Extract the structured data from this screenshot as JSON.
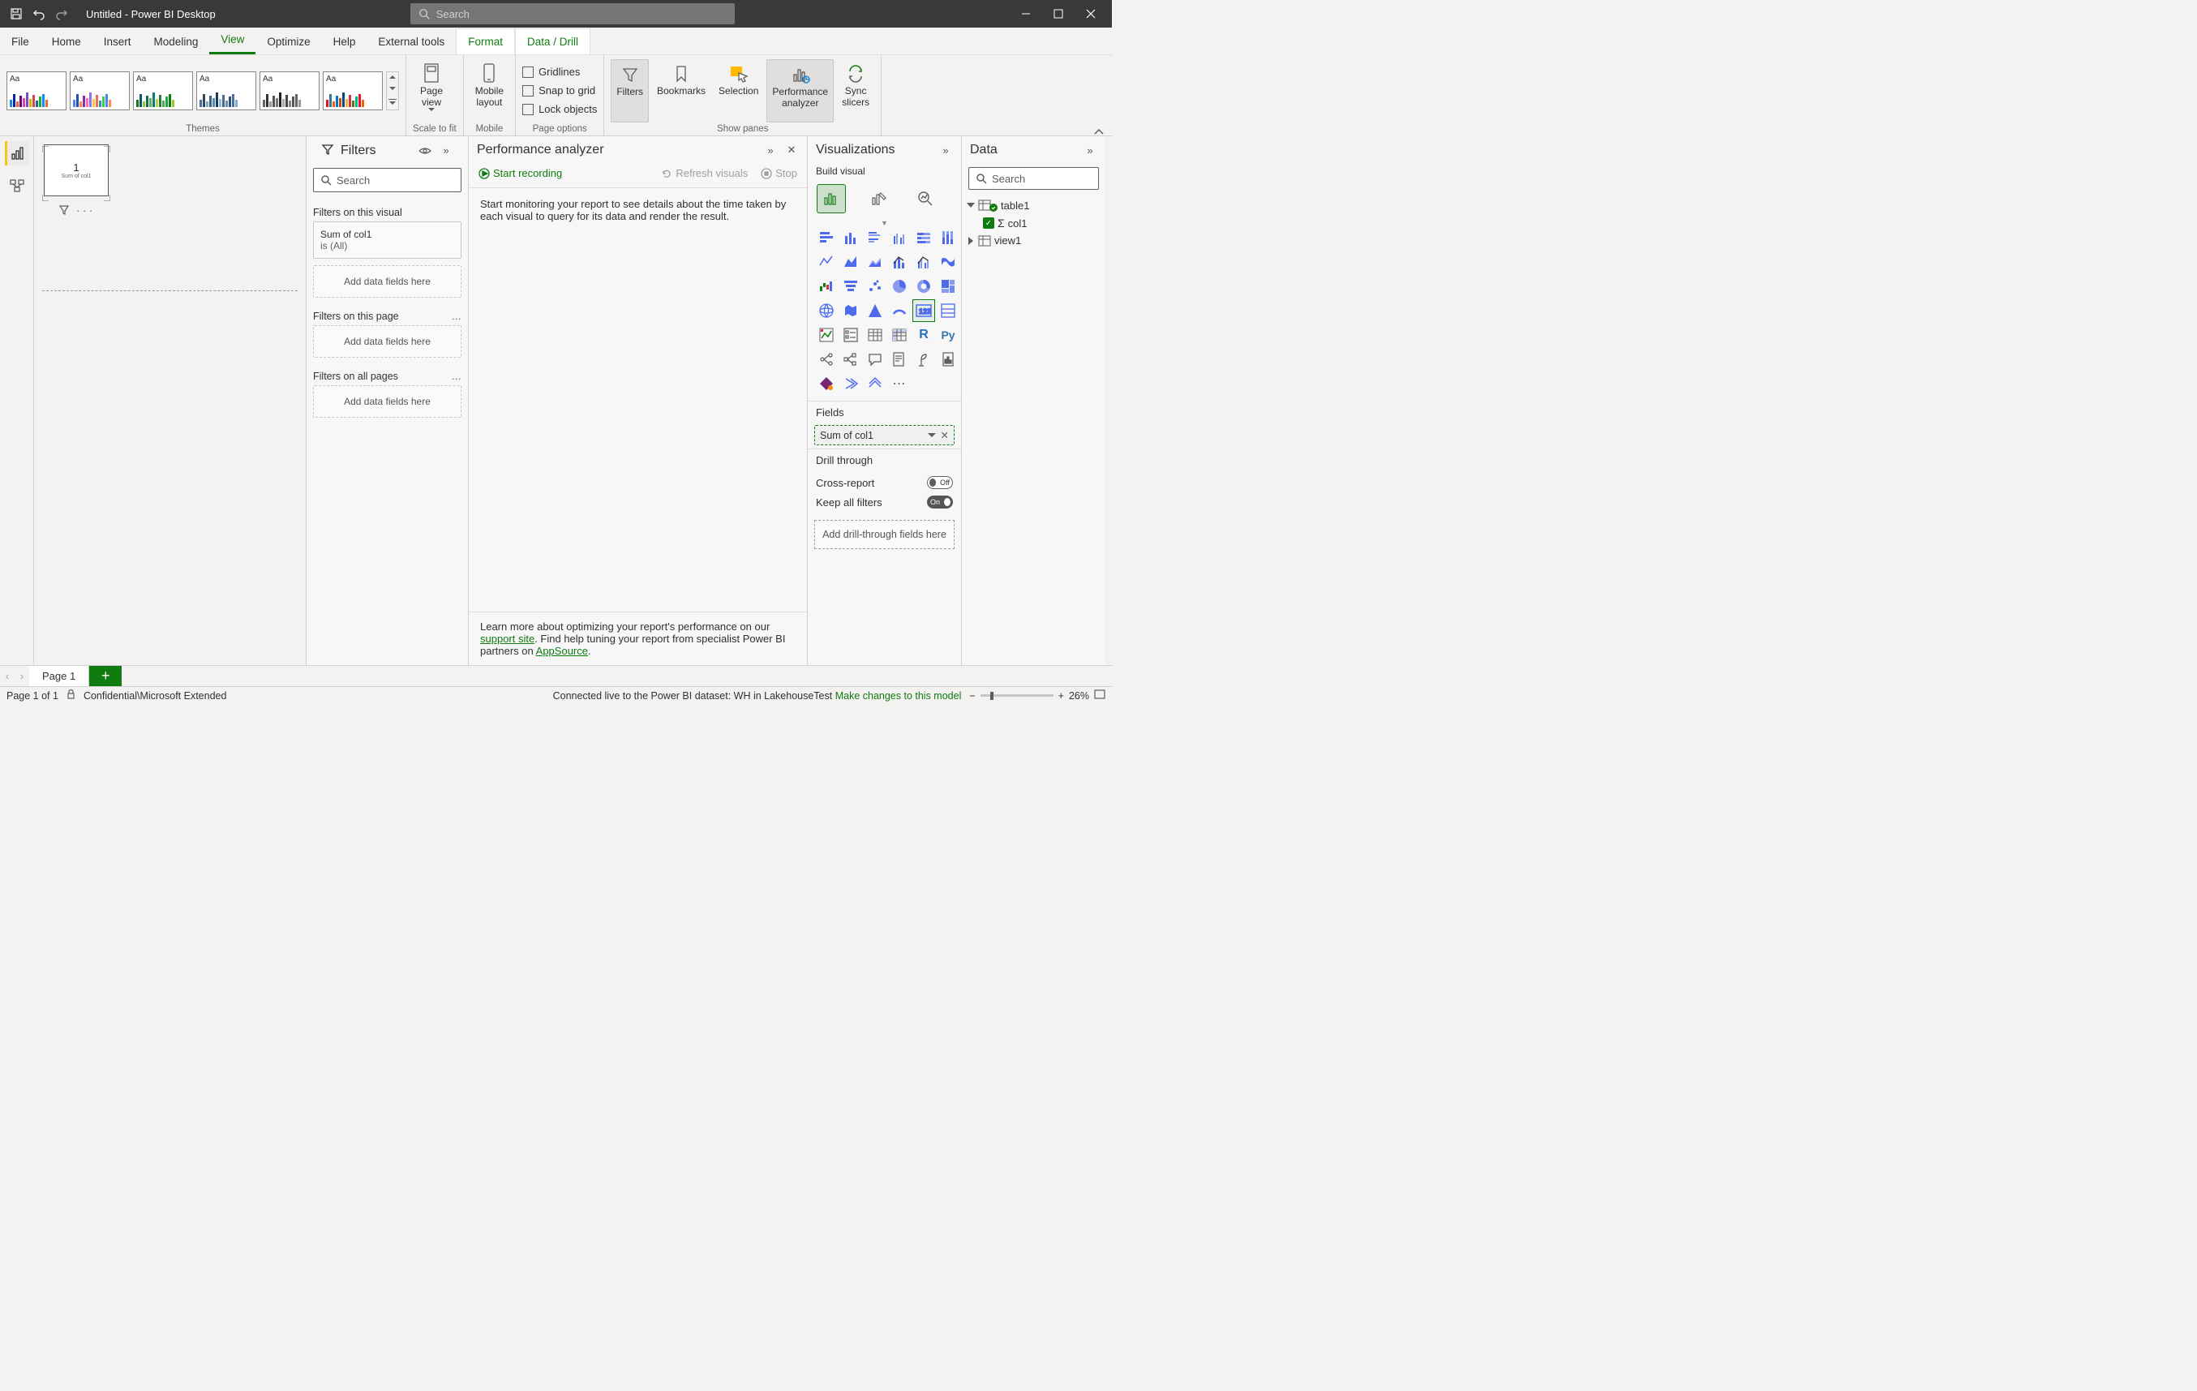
{
  "title": "Untitled - Power BI Desktop",
  "search_placeholder": "Search",
  "window_tabs": {
    "items": [
      "File",
      "Home",
      "Insert",
      "Modeling",
      "View",
      "Optimize",
      "Help",
      "External tools",
      "Format",
      "Data / Drill"
    ],
    "active": "View",
    "contextual": [
      "Format",
      "Data / Drill"
    ]
  },
  "ribbon": {
    "themes_label": "Themes",
    "scale_label": "Scale to fit",
    "page_view": "Page\nview",
    "mobile_label": "Mobile",
    "mobile_layout": "Mobile\nlayout",
    "page_options_label": "Page options",
    "gridlines": "Gridlines",
    "snap": "Snap to grid",
    "lock": "Lock objects",
    "show_panes_label": "Show panes",
    "filters_btn": "Filters",
    "bookmarks_btn": "Bookmarks",
    "selection_btn": "Selection",
    "perf_btn": "Performance\nanalyzer",
    "sync_btn": "Sync\nslicers"
  },
  "canvas": {
    "value": "1",
    "subtitle": "Sum of col1"
  },
  "filters": {
    "title": "Filters",
    "search_placeholder": "Search",
    "sect_visual": "Filters on this visual",
    "card_field": "Sum of col1",
    "card_state": "is (All)",
    "add_here": "Add data fields here",
    "sect_page": "Filters on this page",
    "sect_all": "Filters on all pages"
  },
  "perf": {
    "title": "Performance analyzer",
    "start": "Start recording",
    "refresh": "Refresh visuals",
    "stop": "Stop",
    "body": "Start monitoring your report to see details about the time taken by each visual to query for its data and render the result.",
    "learn1": "Learn more about optimizing your report's performance on our ",
    "support": "support site",
    "learn2": ". Find help tuning your report from specialist Power BI partners on ",
    "appsource": "AppSource",
    "period": "."
  },
  "viz": {
    "title": "Visualizations",
    "build": "Build visual",
    "fields_label": "Fields",
    "field1": "Sum of col1",
    "drill_label": "Drill through",
    "cross": "Cross-report",
    "cross_state": "Off",
    "keep": "Keep all filters",
    "keep_state": "On",
    "add_drill": "Add drill-through fields here"
  },
  "data": {
    "title": "Data",
    "search_placeholder": "Search",
    "table": "table1",
    "col": "col1",
    "view": "view1"
  },
  "page_tabs": {
    "page1": "Page 1"
  },
  "status": {
    "page": "Page 1 of 1",
    "classification": "Confidential\\Microsoft Extended",
    "connection": "Connected live to the Power BI dataset: WH in LakehouseTest ",
    "changes": "Make changes to this model",
    "zoom": "26%"
  }
}
